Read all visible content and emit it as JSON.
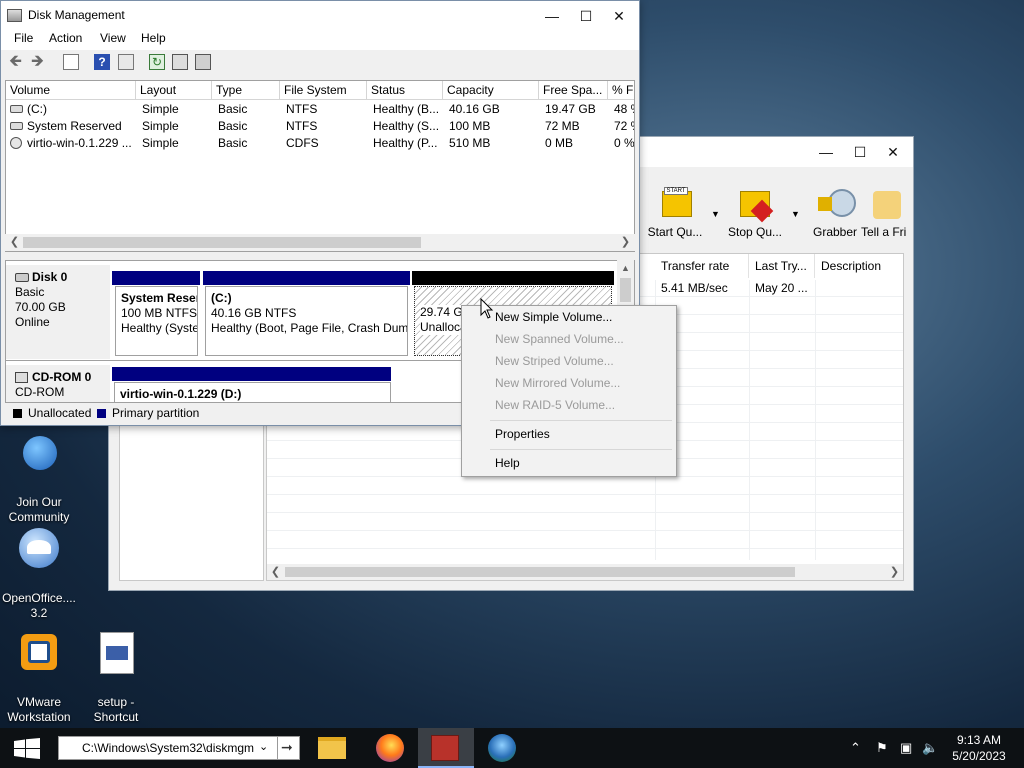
{
  "desktop": {
    "icons": [
      {
        "label": "Join Our\nCommunity"
      },
      {
        "label": "OpenOffice....\n3.2"
      },
      {
        "label": "VMware\nWorkstation"
      },
      {
        "label": "setup -\nShortcut"
      }
    ]
  },
  "bg_window": {
    "toolbar": [
      {
        "label": "Start Qu...",
        "icon": "start-queue-icon"
      },
      {
        "label": "Stop Qu...",
        "icon": "stop-queue-icon"
      },
      {
        "label": "Grabber",
        "icon": "grabber-icon"
      },
      {
        "label": "Tell a Fri",
        "icon": "tell-friend-icon"
      }
    ],
    "columns": [
      "Transfer rate",
      "Last Try...",
      "Description"
    ],
    "row": {
      "rate": "5.41 MB/sec",
      "last_try": "May 20 ...",
      "description": ""
    }
  },
  "disk_management": {
    "title": "Disk Management",
    "menu": [
      "File",
      "Action",
      "View",
      "Help"
    ],
    "columns": [
      "Volume",
      "Layout",
      "Type",
      "File System",
      "Status",
      "Capacity",
      "Free Spa...",
      "% Fr"
    ],
    "volumes": [
      {
        "volume": "(C:)",
        "layout": "Simple",
        "type": "Basic",
        "fs": "NTFS",
        "status": "Healthy (B...",
        "capacity": "40.16 GB",
        "free": "19.47 GB",
        "pct": "48 %"
      },
      {
        "volume": "System Reserved",
        "layout": "Simple",
        "type": "Basic",
        "fs": "NTFS",
        "status": "Healthy (S...",
        "capacity": "100 MB",
        "free": "72 MB",
        "pct": "72 %"
      },
      {
        "volume": "virtio-win-0.1.229 ...",
        "layout": "Simple",
        "type": "Basic",
        "fs": "CDFS",
        "status": "Healthy (P...",
        "capacity": "510 MB",
        "free": "0 MB",
        "pct": "0 %"
      }
    ],
    "disks": [
      {
        "name": "Disk 0",
        "kind": "Basic",
        "size": "70.00 GB",
        "state": "Online"
      },
      {
        "name": "CD-ROM 0",
        "kind": "CD-ROM"
      }
    ],
    "partitions": {
      "sysres": {
        "name": "System Reser",
        "size": "100 MB NTFS",
        "status": "Healthy (Syste"
      },
      "c": {
        "name": "(C:)",
        "size": "40.16 GB NTFS",
        "status": "Healthy (Boot, Page File, Crash Dum|"
      },
      "unalloc": {
        "size": "29.74 GE",
        "status": "Unalloca"
      },
      "cd": {
        "name": "virtio-win-0.1.229  (D:)"
      }
    },
    "legend": [
      "Unallocated",
      "Primary partition"
    ],
    "colors": {
      "unallocated": "#000000",
      "primary": "#000080"
    }
  },
  "context_menu": {
    "items": [
      {
        "label": "New Simple Volume...",
        "enabled": true
      },
      {
        "label": "New Spanned Volume...",
        "enabled": false
      },
      {
        "label": "New Striped Volume...",
        "enabled": false
      },
      {
        "label": "New Mirrored Volume...",
        "enabled": false
      },
      {
        "label": "New RAID-5 Volume...",
        "enabled": false
      },
      {
        "label": "Properties",
        "enabled": true
      },
      {
        "label": "Help",
        "enabled": true
      }
    ]
  },
  "taskbar": {
    "address": "C:\\Windows\\System32\\diskmgm",
    "time": "9:13 AM",
    "date": "5/20/2023"
  }
}
